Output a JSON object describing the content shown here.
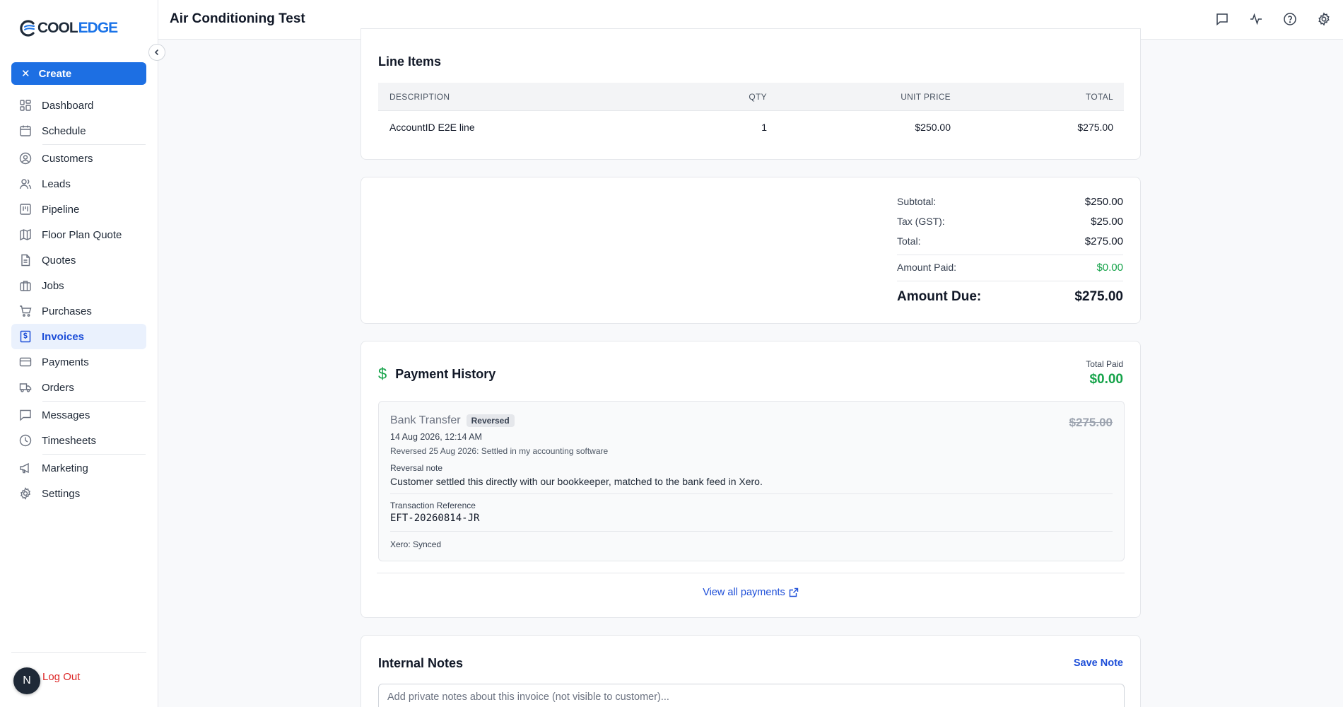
{
  "brand": {
    "part1": "COOL",
    "part2": "EDGE"
  },
  "header": {
    "title": "Air Conditioning Test"
  },
  "sidebar": {
    "create_label": "Create",
    "items": [
      {
        "label": "Dashboard",
        "icon": "dashboard-icon"
      },
      {
        "label": "Schedule",
        "icon": "calendar-icon"
      },
      {
        "label": "Customers",
        "icon": "user-circle-icon"
      },
      {
        "label": "Leads",
        "icon": "users-icon"
      },
      {
        "label": "Pipeline",
        "icon": "kanban-icon"
      },
      {
        "label": "Floor Plan Quote",
        "icon": "map-icon"
      },
      {
        "label": "Quotes",
        "icon": "document-icon"
      },
      {
        "label": "Jobs",
        "icon": "briefcase-icon"
      },
      {
        "label": "Purchases",
        "icon": "cart-icon"
      },
      {
        "label": "Invoices",
        "icon": "invoice-icon",
        "active": true
      },
      {
        "label": "Payments",
        "icon": "credit-card-icon"
      },
      {
        "label": "Orders",
        "icon": "truck-icon"
      },
      {
        "label": "Messages",
        "icon": "chat-icon"
      },
      {
        "label": "Timesheets",
        "icon": "clock-icon"
      },
      {
        "label": "Marketing",
        "icon": "megaphone-icon"
      },
      {
        "label": "Settings",
        "icon": "gear-icon"
      }
    ],
    "avatar_initial": "N",
    "logout_label": "Log Out"
  },
  "line_items": {
    "title": "Line Items",
    "columns": [
      "DESCRIPTION",
      "QTY",
      "UNIT PRICE",
      "TOTAL"
    ],
    "rows": [
      {
        "description": "AccountID E2E line",
        "qty": "1",
        "unit_price": "$250.00",
        "total": "$275.00"
      }
    ]
  },
  "totals": {
    "subtotal_label": "Subtotal:",
    "subtotal": "$250.00",
    "tax_label": "Tax (GST):",
    "tax": "$25.00",
    "total_label": "Total:",
    "total": "$275.00",
    "paid_label": "Amount Paid:",
    "paid": "$0.00",
    "due_label": "Amount Due:",
    "due": "$275.00"
  },
  "payment_history": {
    "title": "Payment History",
    "total_paid_label": "Total Paid",
    "total_paid": "$0.00",
    "entry": {
      "method": "Bank Transfer",
      "badge": "Reversed",
      "amount": "$275.00",
      "date": "14 Aug 2026, 12:14 AM",
      "reversed_info": "Reversed 25 Aug 2026: Settled in my accounting software",
      "reversal_note_label": "Reversal note",
      "reversal_note": "Customer settled this directly with our bookkeeper, matched to the bank feed in Xero.",
      "txn_ref_label": "Transaction Reference",
      "txn_ref": "EFT-20260814-JR",
      "xero_status": "Xero: Synced"
    },
    "view_all_label": "View all payments"
  },
  "notes": {
    "title": "Internal Notes",
    "save_label": "Save Note",
    "placeholder": "Add private notes about this invoice (not visible to customer)...",
    "value": ""
  },
  "colors": {
    "accent": "#1d6fe3",
    "success": "#16a34a",
    "danger": "#dc2626"
  }
}
